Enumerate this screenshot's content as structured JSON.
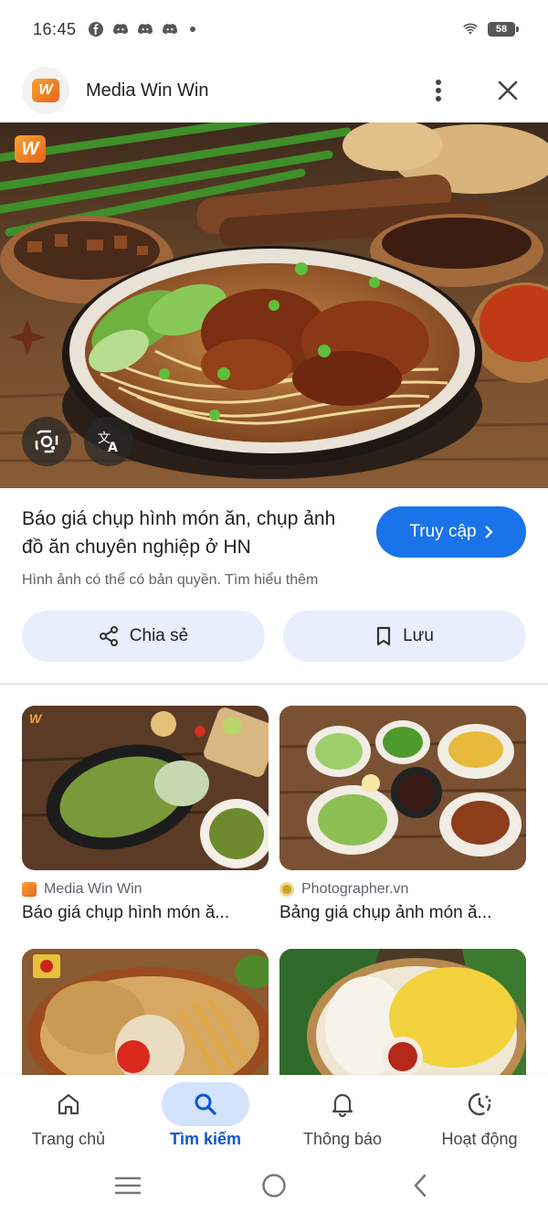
{
  "status_bar": {
    "time": "16:45",
    "icons": [
      "facebook-icon",
      "discord-icon",
      "discord-icon",
      "discord-icon"
    ],
    "battery": "58"
  },
  "header": {
    "site_name": "Media Win Win",
    "logo_letter": "W"
  },
  "hero": {
    "watermark": "W"
  },
  "info": {
    "title": "Báo giá chụp hình món ăn, chụp ảnh đồ ăn chuyên nghiệp ở HN",
    "visit_label": "Truy cập",
    "copyright": "Hình ảnh có thể có bản quyền. Tìm hiểu thêm"
  },
  "actions": {
    "share_label": "Chia sẻ",
    "save_label": "Lưu"
  },
  "results": [
    {
      "source": "Media Win Win",
      "title": "Báo giá chụp hình món ă...",
      "source_color": "#f08a24"
    },
    {
      "source": "Photographer.vn",
      "title": "Bảng giá chụp ảnh món ă...",
      "source_color": "#c9a227"
    },
    {
      "source": "",
      "title": ""
    },
    {
      "source": "",
      "title": ""
    }
  ],
  "bottom_nav": {
    "items": [
      {
        "label": "Trang chủ",
        "icon": "home-icon"
      },
      {
        "label": "Tìm kiếm",
        "icon": "search-icon",
        "active": true
      },
      {
        "label": "Thông báo",
        "icon": "bell-icon"
      },
      {
        "label": "Hoạt động",
        "icon": "activity-icon"
      }
    ]
  },
  "colors": {
    "accent": "#1a73e8",
    "pill_bg": "#e8eefb",
    "active_nav": "#d3e3fd"
  }
}
